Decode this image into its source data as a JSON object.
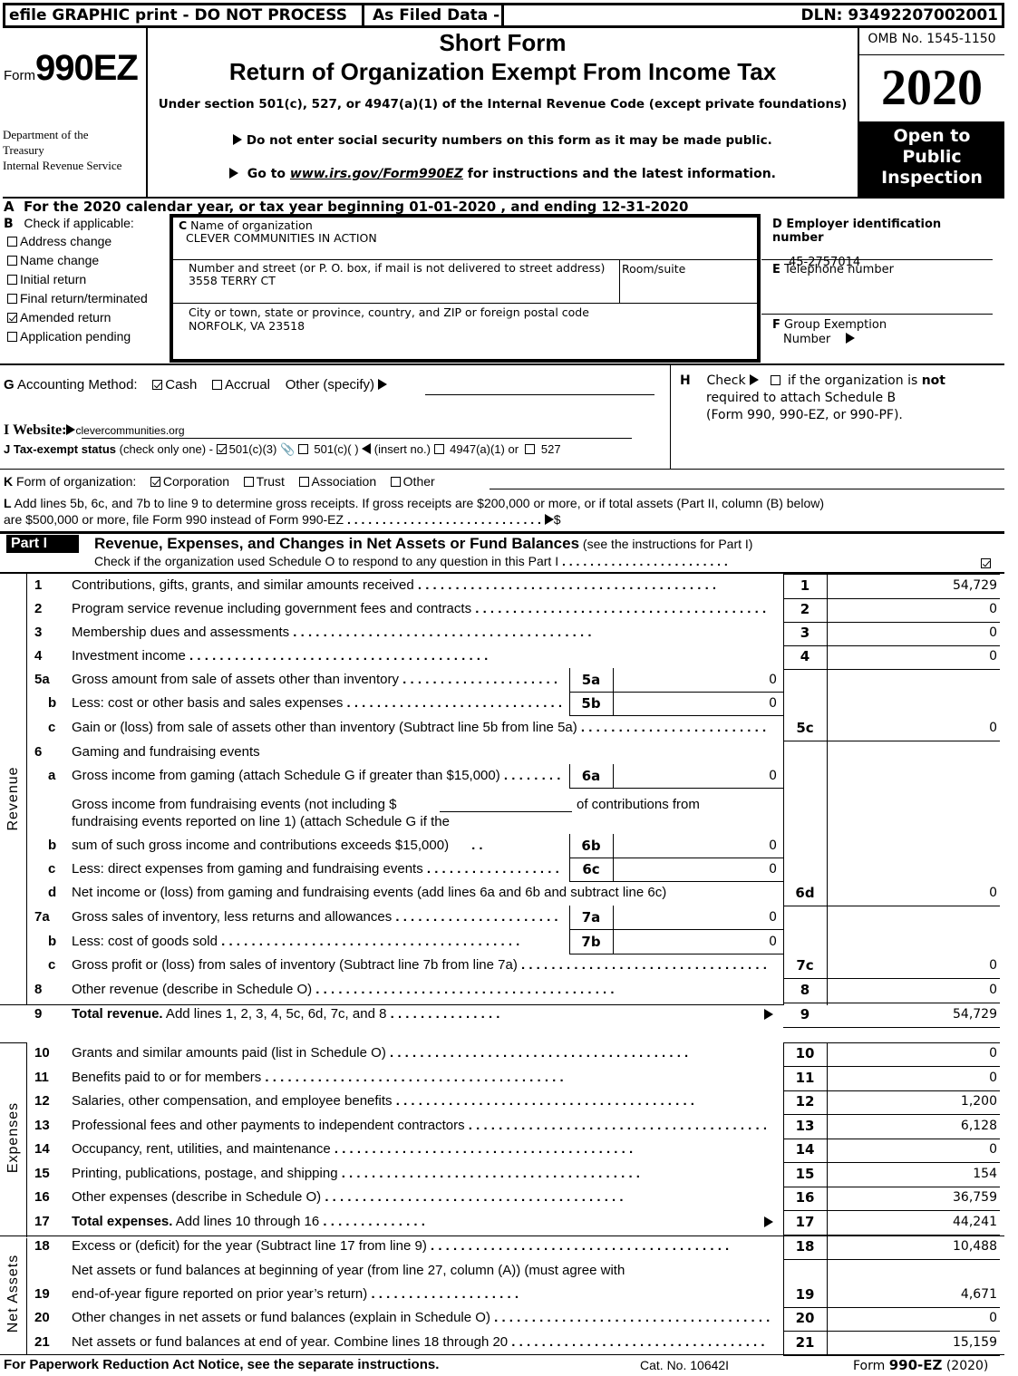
{
  "banner": {
    "efile": "efile GRAPHIC print - DO NOT PROCESS",
    "filed": "As Filed Data -",
    "dln": "DLN: 93492207002001"
  },
  "header": {
    "form_prefix": "Form",
    "form_number": "990EZ",
    "dept_line1": "Department of the",
    "dept_line2": "Treasury",
    "dept_line3": "Internal Revenue Service",
    "title1": "Short Form",
    "title2": "Return of Organization Exempt From Income Tax",
    "subtitle": "Under section 501(c), 527, or 4947(a)(1) of the Internal Revenue Code (except private foundations)",
    "notice1": "Do not enter social security numbers on this form as it may be made public.",
    "notice2_pre": "Go to ",
    "notice2_link": "www.irs.gov/Form990EZ",
    "notice2_post": " for instructions and the latest information.",
    "omb": "OMB No. 1545-1150",
    "year": "2020",
    "open_line1": "Open to",
    "open_line2": "Public",
    "open_line3": "Inspection"
  },
  "section_a": "A  For the 2020 calendar year, or tax year beginning 01-01-2020 , and ending 12-31-2020",
  "section_b": {
    "label": "B",
    "title": "Check if applicable:",
    "items": [
      {
        "label": "Address change",
        "checked": false
      },
      {
        "label": "Name change",
        "checked": false
      },
      {
        "label": "Initial return",
        "checked": false
      },
      {
        "label": "Final return/terminated",
        "checked": false
      },
      {
        "label": "Amended return",
        "checked": true
      },
      {
        "label": "Application pending",
        "checked": false
      }
    ]
  },
  "section_c": {
    "name_label_letter": "C",
    "name_label": " Name of organization",
    "name_value": "CLEVER COMMUNITIES IN ACTION",
    "street_label": "Number and street (or P. O. box, if mail is not delivered to street address)",
    "room_label": "Room/suite",
    "street_value": "3558 TERRY CT",
    "city_label": " City or town, state or province, country, and ZIP or foreign postal code",
    "city_value": "NORFOLK, VA  23518"
  },
  "section_d": {
    "label": "D Employer identification number",
    "value": "45-2757014"
  },
  "section_e": {
    "letter": "E",
    "label": " Telephone number",
    "value": ""
  },
  "section_f": {
    "letter": "F",
    "label1": " Group Exemption",
    "label2": "Number"
  },
  "section_g": {
    "letter": "G",
    "label": " Accounting Method:",
    "cash": "Cash",
    "cash_checked": true,
    "accrual": "Accrual",
    "accrual_checked": false,
    "other": "Other (specify)",
    "other_value": ""
  },
  "section_h": {
    "letter": "H",
    "line1_pre": "Check",
    "line1_post": " if the organization is ",
    "line1_bold": "not",
    "line2": "required to attach Schedule B",
    "line3": "(Form 990, 990-EZ, or 990-PF).",
    "checked": false
  },
  "section_i": {
    "label": "I Website:",
    "value": "clevercommunities.org"
  },
  "section_j": {
    "label_bold": "J Tax-exempt status",
    "label_rest": " (check only one) -",
    "opt1": "501(c)(3)",
    "opt1_checked": true,
    "opt2": "501(c)(  )",
    "opt2_insert": "(insert no.)",
    "opt3": "4947(a)(1) or",
    "opt4": "527"
  },
  "section_k": {
    "letter": "K",
    "label": " Form of organization:",
    "options": [
      {
        "label": "Corporation",
        "checked": true
      },
      {
        "label": "Trust",
        "checked": false
      },
      {
        "label": "Association",
        "checked": false
      },
      {
        "label": "Other",
        "checked": false
      }
    ]
  },
  "section_l": {
    "letter": "L",
    "line1": " Add lines 5b, 6c, and 7b to line 9 to determine gross receipts. If gross receipts are $200,000 or more, or if total assets (Part II, column (B) below)",
    "line2": "are $500,000 or more, file Form 990 instead of Form 990-EZ",
    "dollar": "$",
    "value": ""
  },
  "part1": {
    "tag": "Part I",
    "title": "Revenue, Expenses, and Changes in Net Assets or Fund Balances",
    "title_note": " (see the instructions for Part I)",
    "check_text": "Check if the organization used Schedule O to respond to any question in this Part I",
    "check_checked": true,
    "side_labels": {
      "revenue": "Revenue",
      "expenses": "Expenses",
      "net_assets": "Net Assets"
    },
    "lines": {
      "l1": {
        "num": "1",
        "text": "Contributions, gifts, grants, and similar amounts received",
        "box": "1",
        "value": "54,729"
      },
      "l2": {
        "num": "2",
        "text": "Program service revenue including government fees and contracts",
        "box": "2",
        "value": "0"
      },
      "l3": {
        "num": "3",
        "text": "Membership dues and assessments",
        "box": "3",
        "value": "0"
      },
      "l4": {
        "num": "4",
        "text": "Investment income",
        "box": "4",
        "value": "0"
      },
      "l5a": {
        "num": "5a",
        "text": "Gross amount from sale of assets other than inventory",
        "box": "5a",
        "value": "0"
      },
      "l5b": {
        "num": "b",
        "text": "Less: cost or other basis and sales expenses",
        "box": "5b",
        "value": "0"
      },
      "l5c": {
        "num": "c",
        "text": "Gain or (loss) from sale of assets other than inventory (Subtract line 5b from line 5a)",
        "box": "5c",
        "value": "0"
      },
      "l6": {
        "num": "6",
        "text": "Gaming and fundraising events"
      },
      "l6a": {
        "num": "a",
        "text": "Gross income from gaming (attach Schedule G if greater than $15,000)",
        "box": "6a",
        "value": "0"
      },
      "l6b": {
        "num": "b",
        "text1": "Gross income from fundraising events (not including $",
        "text1b": "of contributions from",
        "text2": "fundraising events reported on line 1) (attach Schedule G if the",
        "text3": "sum of such gross income and contributions exceeds $15,000)",
        "box": "6b",
        "value": "0",
        "excluded_amount": ""
      },
      "l6c": {
        "num": "c",
        "text": "Less: direct expenses from gaming and fundraising events",
        "box": "6c",
        "value": "0"
      },
      "l6d": {
        "num": "d",
        "text": "Net income or (loss) from gaming and fundraising events (add lines 6a and 6b and subtract line 6c)",
        "box": "6d",
        "value": "0"
      },
      "l7a": {
        "num": "7a",
        "text": "Gross sales of inventory, less returns and allowances",
        "box": "7a",
        "value": "0"
      },
      "l7b": {
        "num": "b",
        "text": "Less: cost of goods sold",
        "box": "7b",
        "value": "0"
      },
      "l7c": {
        "num": "c",
        "text": "Gross profit or (loss) from sales of inventory (Subtract line 7b from line 7a)",
        "box": "7c",
        "value": "0"
      },
      "l8": {
        "num": "8",
        "text": "Other revenue (describe in Schedule O)",
        "box": "8",
        "value": "0"
      },
      "l9": {
        "num": "9",
        "text_bold": "Total revenue.",
        "text": " Add lines 1, 2, 3, 4, 5c, 6d, 7c, and 8",
        "box": "9",
        "value": "54,729"
      },
      "l10": {
        "num": "10",
        "text": "Grants and similar amounts paid (list in Schedule O)",
        "box": "10",
        "value": "0"
      },
      "l11": {
        "num": "11",
        "text": "Benefits paid to or for members",
        "box": "11",
        "value": "0"
      },
      "l12": {
        "num": "12",
        "text": "Salaries, other compensation, and employee benefits",
        "box": "12",
        "value": "1,200"
      },
      "l13": {
        "num": "13",
        "text": "Professional fees and other payments to independent contractors",
        "box": "13",
        "value": "6,128"
      },
      "l14": {
        "num": "14",
        "text": "Occupancy, rent, utilities, and maintenance",
        "box": "14",
        "value": "0"
      },
      "l15": {
        "num": "15",
        "text": "Printing, publications, postage, and shipping",
        "box": "15",
        "value": "154"
      },
      "l16": {
        "num": "16",
        "text": "Other expenses (describe in Schedule O)",
        "box": "16",
        "value": "36,759"
      },
      "l17": {
        "num": "17",
        "text_bold": "Total expenses.",
        "text": " Add lines 10 through 16",
        "box": "17",
        "value": "44,241"
      },
      "l18": {
        "num": "18",
        "text": "Excess or (deficit) for the year (Subtract line 17 from line 9)",
        "box": "18",
        "value": "10,488"
      },
      "l19": {
        "num": "19",
        "text1": "Net assets or fund balances at beginning of year (from line 27, column (A)) (must agree with",
        "text2": "end-of-year figure reported on prior year’s return)",
        "box": "19",
        "value": "4,671"
      },
      "l20": {
        "num": "20",
        "text": "Other changes in net assets or fund balances (explain in Schedule O)",
        "box": "20",
        "value": "0"
      },
      "l21": {
        "num": "21",
        "text": "Net assets or fund balances at end of year. Combine lines 18 through 20",
        "box": "21",
        "value": "15,159"
      }
    }
  },
  "footer": {
    "paperwork": "For Paperwork Reduction Act Notice, see the separate instructions.",
    "cat": "Cat. No. 10642I",
    "form_pre": "Form ",
    "form_bold": "990-EZ",
    "form_post": " (2020)"
  }
}
